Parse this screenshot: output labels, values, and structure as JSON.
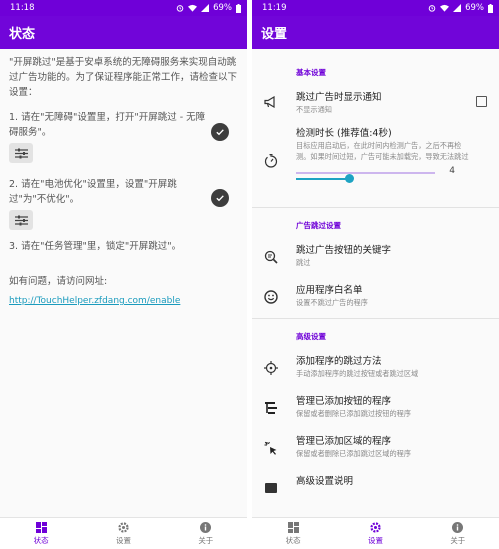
{
  "left": {
    "status_bar": {
      "time": "11:18",
      "battery": "69%"
    },
    "title": "状态",
    "intro": "\"开屏跳过\"是基于安卓系统的无障碍服务来实现自动跳过广告功能的。为了保证程序能正常工作，请检查以下设置：",
    "steps": [
      "1. 请在\"无障碍\"设置里，打开\"开屏跳过 - 无障碍服务\"。",
      "2. 请在\"电池优化\"设置里，设置\"开屏跳过\"为\"不优化\"。",
      "3. 请在\"任务管理\"里，锁定\"开屏跳过\"。"
    ],
    "help_text": "如有问题，请访问网址:",
    "help_link": "http://TouchHelper.zfdang.com/enable",
    "nav": [
      {
        "label": "状态",
        "icon": "dashboard-icon"
      },
      {
        "label": "设置",
        "icon": "settings-icon"
      },
      {
        "label": "关于",
        "icon": "info-icon"
      }
    ],
    "active_nav": 0
  },
  "right": {
    "status_bar": {
      "time": "11:19",
      "battery": "69%"
    },
    "title": "设置",
    "sections": [
      {
        "header": "基本设置",
        "items": [
          {
            "title": "跳过广告时显示通知",
            "summary": "不显示通知",
            "icon": "megaphone-icon",
            "checkbox": true,
            "checked": false
          },
          {
            "title": "检测时长 (推荐值:4秒)",
            "summary": "目标应用启动后，在此时间内检测广告，之后不再检测。如果时间过短，广告可能未加载完，导致无法跳过",
            "icon": "timer-icon",
            "slider": {
              "value": 4,
              "max": 10,
              "fraction": 0.38
            }
          }
        ]
      },
      {
        "header": "广告跳过设置",
        "items": [
          {
            "title": "跳过广告按钮的关键字",
            "summary": "跳过",
            "icon": "keyword-search-icon"
          },
          {
            "title": "应用程序白名单",
            "summary": "设置不跳过广告的程序",
            "icon": "smile-icon"
          }
        ]
      },
      {
        "header": "高级设置",
        "items": [
          {
            "title": "添加程序的跳过方法",
            "summary": "手动添加程序的跳过按钮或者跳过区域",
            "icon": "crosshair-icon"
          },
          {
            "title": "管理已添加按钮的程序",
            "summary": "保留或者删除已添加跳过按钮的程序",
            "icon": "list-manage-icon"
          },
          {
            "title": "管理已添加区域的程序",
            "summary": "保留或者删除已添加跳过区域的程序",
            "icon": "tap-area-icon"
          },
          {
            "title": "高级设置说明",
            "summary": "",
            "icon": "book-icon"
          }
        ]
      }
    ],
    "nav": [
      {
        "label": "状态",
        "icon": "dashboard-icon"
      },
      {
        "label": "设置",
        "icon": "settings-icon"
      },
      {
        "label": "关于",
        "icon": "info-icon"
      }
    ],
    "active_nav": 1
  },
  "colors": {
    "accent": "#7105d9",
    "status_bar": "#6f00d8",
    "link": "#1a9bbd",
    "slider": "#1ea3c3"
  }
}
